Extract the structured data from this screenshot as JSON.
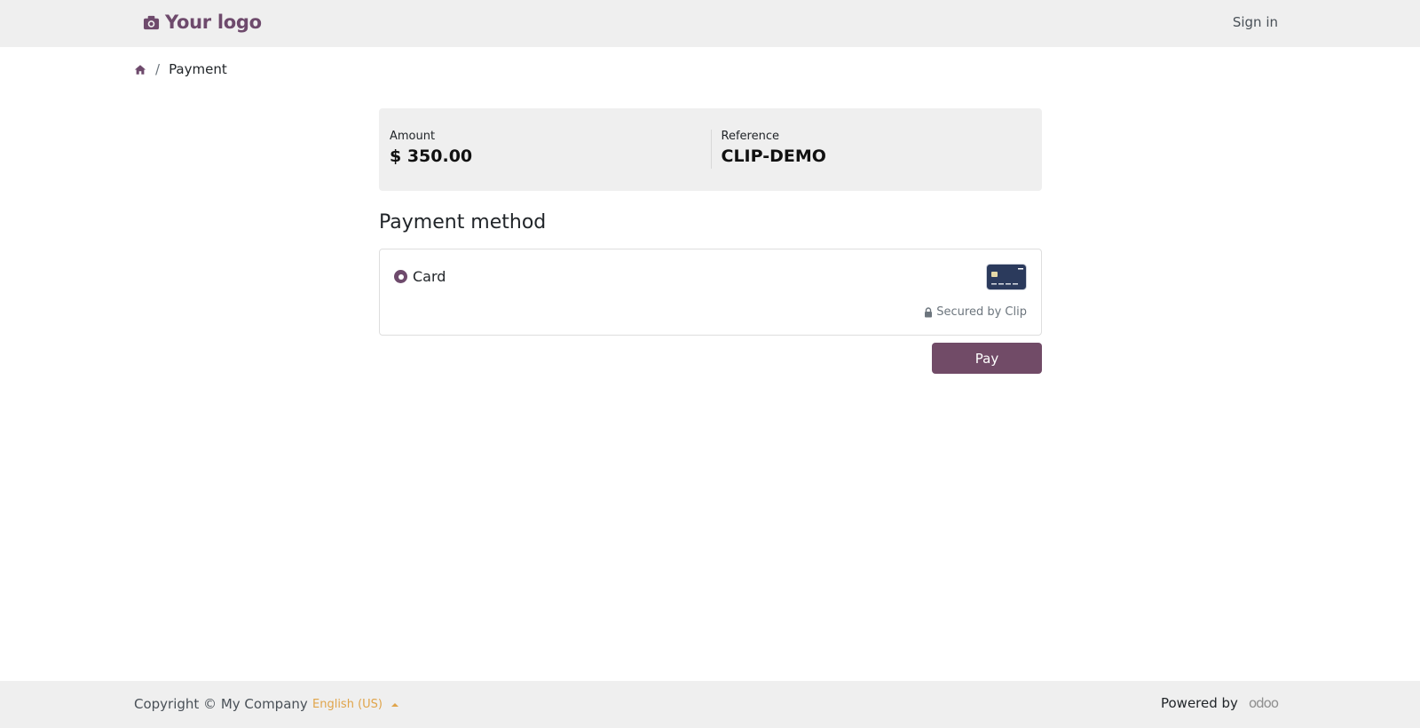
{
  "header": {
    "logo_text": "Your logo",
    "signin_label": "Sign in"
  },
  "breadcrumb": {
    "home_icon": "home-icon",
    "current": "Payment"
  },
  "summary": {
    "amount_label": "Amount",
    "amount_value": "$ 350.00",
    "reference_label": "Reference",
    "reference_value": "CLIP-DEMO"
  },
  "payment": {
    "title": "Payment method",
    "method_label": "Card",
    "method_selected": true,
    "secured_text": "Secured by Clip",
    "pay_label": "Pay"
  },
  "footer": {
    "copyright": "Copyright © My Company",
    "language": "English (US)",
    "powered_by": "Powered by",
    "powered_logo": "odoo"
  },
  "colors": {
    "brand": "#714b67",
    "header_bg": "#efefef",
    "lang_link": "#e0a44a",
    "card_icon": "#2b3a5c"
  }
}
